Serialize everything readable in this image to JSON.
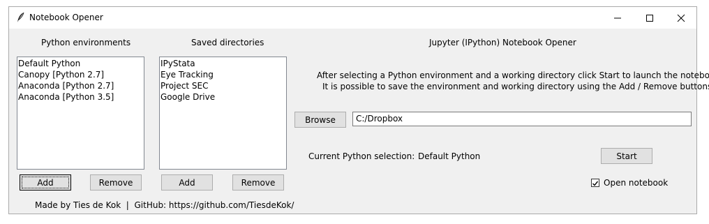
{
  "window": {
    "title": "Notebook Opener"
  },
  "left": {
    "envs_heading": "Python environments",
    "envs": [
      "Default Python",
      "Canopy [Python 2.7]",
      "Anaconda [Python 2.7]",
      "Anaconda [Python 3.5]"
    ],
    "env_add": "Add",
    "env_remove": "Remove",
    "dirs_heading": "Saved directories",
    "dirs": [
      "IPyStata",
      "Eye Tracking",
      "Project SEC",
      "Google Drive"
    ],
    "dir_add": "Add",
    "dir_remove": "Remove",
    "footer": "Made by Ties de Kok  |  GitHub: https://github.com/TiesdeKok/"
  },
  "right": {
    "heading": "Jupyter (IPython) Notebook Opener",
    "info_line1": "After selecting a Python environment and a working directory click Start to launch the notebook.",
    "info_line2": "It is possible to save the environment and working directory using the Add / Remove buttons.",
    "browse": "Browse",
    "directory_value": "C:/Dropbox",
    "current_label": "Current Python selection:",
    "current_value": "Default Python",
    "start": "Start",
    "open_notebook_label": "Open notebook",
    "open_notebook_checked": true
  }
}
